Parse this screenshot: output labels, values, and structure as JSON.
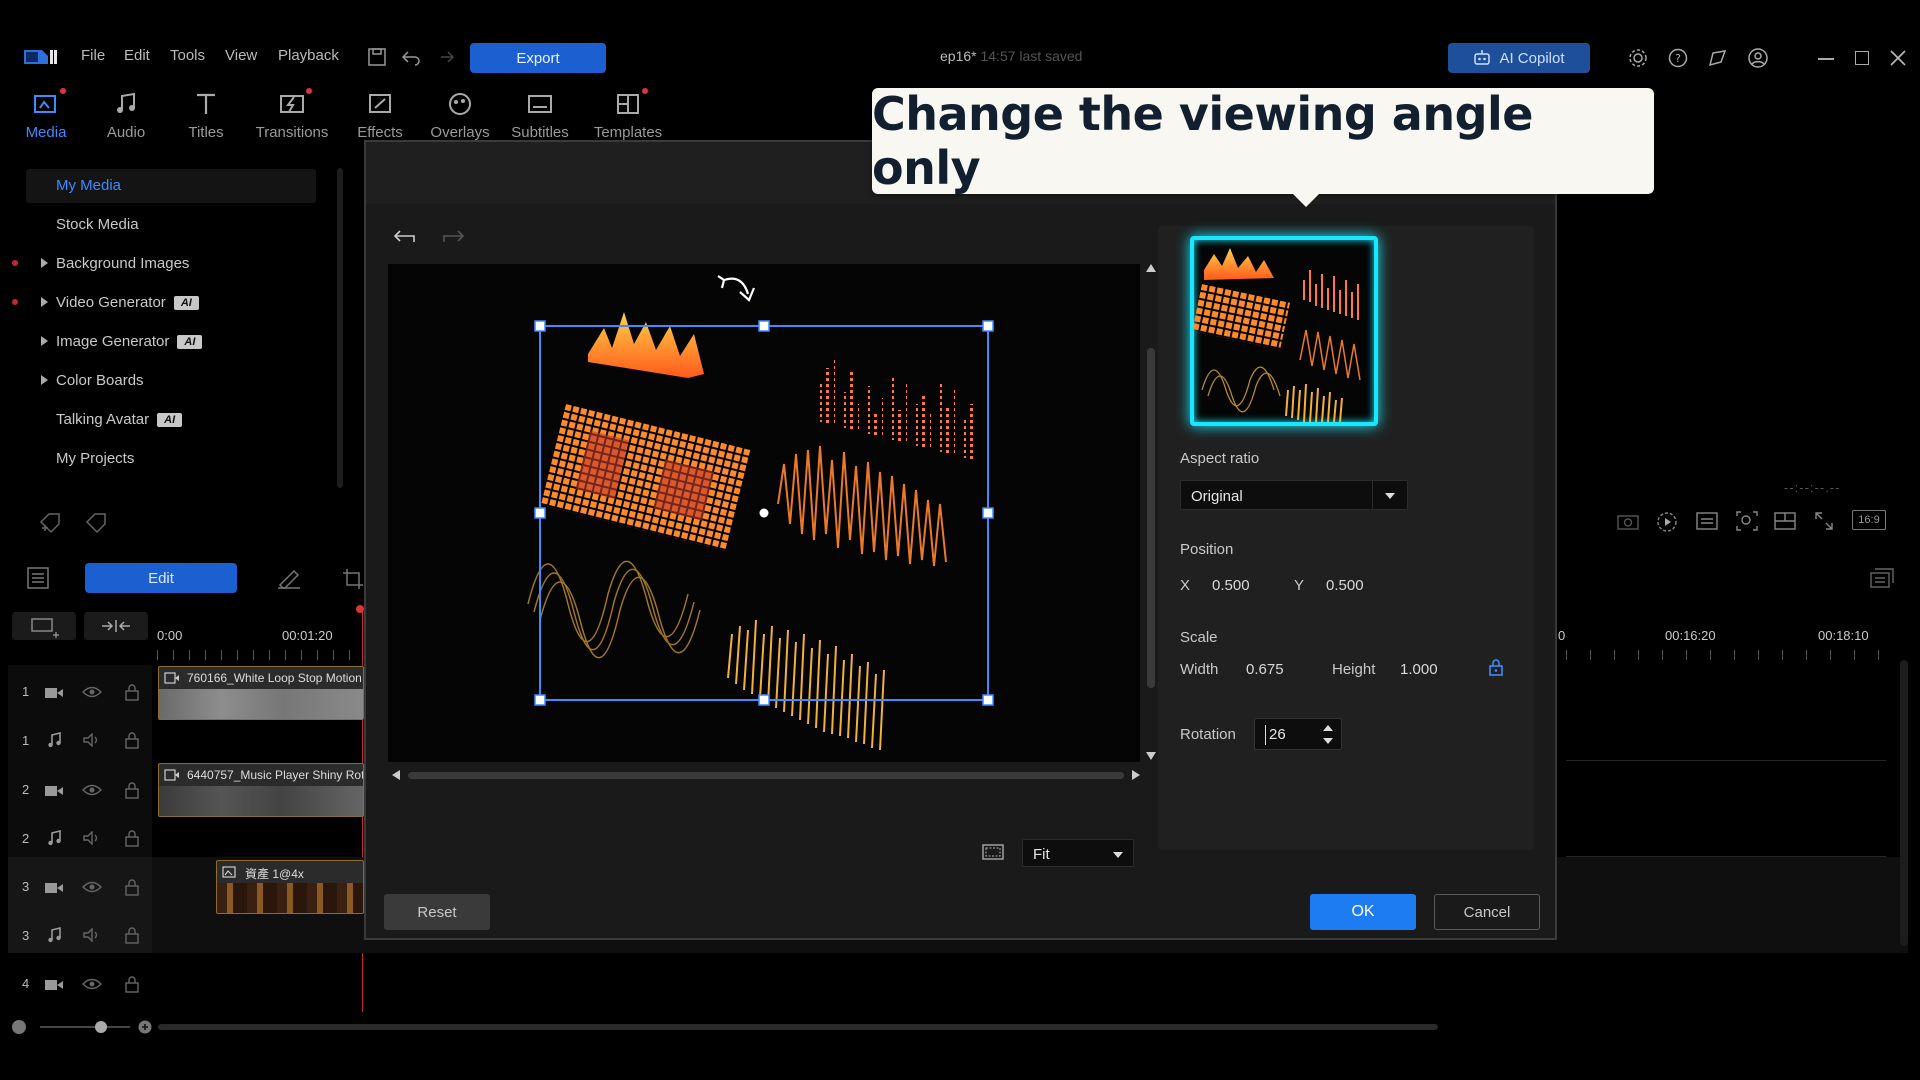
{
  "menu": [
    "File",
    "Edit",
    "Tools",
    "View",
    "Playback"
  ],
  "toolbar": {
    "export_label": "Export"
  },
  "project": {
    "name": "ep16*",
    "status": "14:57 last saved"
  },
  "copilot": {
    "label": "AI Copilot"
  },
  "tabs": [
    {
      "label": "Media",
      "icon": "media-icon"
    },
    {
      "label": "Audio",
      "icon": "music-note-icon"
    },
    {
      "label": "Titles",
      "icon": "text-t-icon"
    },
    {
      "label": "Transitions",
      "icon": "transition-icon"
    },
    {
      "label": "Effects",
      "icon": "effects-icon"
    },
    {
      "label": "Overlays",
      "icon": "overlay-icon"
    },
    {
      "label": "Subtitles",
      "icon": "subtitles-icon"
    },
    {
      "label": "Templates",
      "icon": "templates-icon"
    }
  ],
  "library": {
    "items": [
      {
        "label": "My Media"
      },
      {
        "label": "Stock Media"
      },
      {
        "label": "Background Images"
      },
      {
        "label": "Video Generator",
        "badge": "AI"
      },
      {
        "label": "Image Generator",
        "badge": "AI"
      },
      {
        "label": "Color Boards"
      },
      {
        "label": "Talking Avatar",
        "badge": "AI"
      },
      {
        "label": "My Projects"
      }
    ]
  },
  "edit_button": {
    "label": "Edit"
  },
  "timeline": {
    "start_time": "0:00",
    "time_markers": [
      "00:01:20",
      "0",
      "00:16:20",
      "00:18:10"
    ],
    "track_numbers": [
      "1",
      "1",
      "2",
      "2",
      "3",
      "3",
      "4"
    ],
    "clips": [
      {
        "label": "760166_White Loop Stop Motion"
      },
      {
        "label": "6440757_Music Player Shiny Rot"
      },
      {
        "label": "資產 1@4x"
      }
    ]
  },
  "callout": {
    "text": "Change the viewing angle only"
  },
  "dialog": {
    "aspect_ratio_label": "Aspect ratio",
    "aspect_ratio_value": "Original",
    "position_label": "Position",
    "x_label": "X",
    "x_value": "0.500",
    "y_label": "Y",
    "y_value": "0.500",
    "scale_label": "Scale",
    "width_label": "Width",
    "width_value": "0.675",
    "height_label": "Height",
    "height_value": "1.000",
    "rotation_label": "Rotation",
    "rotation_value": "26",
    "zoom_value": "Fit",
    "reset_label": "Reset",
    "ok_label": "OK",
    "cancel_label": "Cancel"
  },
  "preview": {
    "ratio_label": "16:9",
    "timecode": "--:--:--.--"
  },
  "colors": {
    "accent": "#1d7cf2",
    "selection": "#3d8bff",
    "callout_text": "#111f2f",
    "glow": "#19e6ff"
  }
}
